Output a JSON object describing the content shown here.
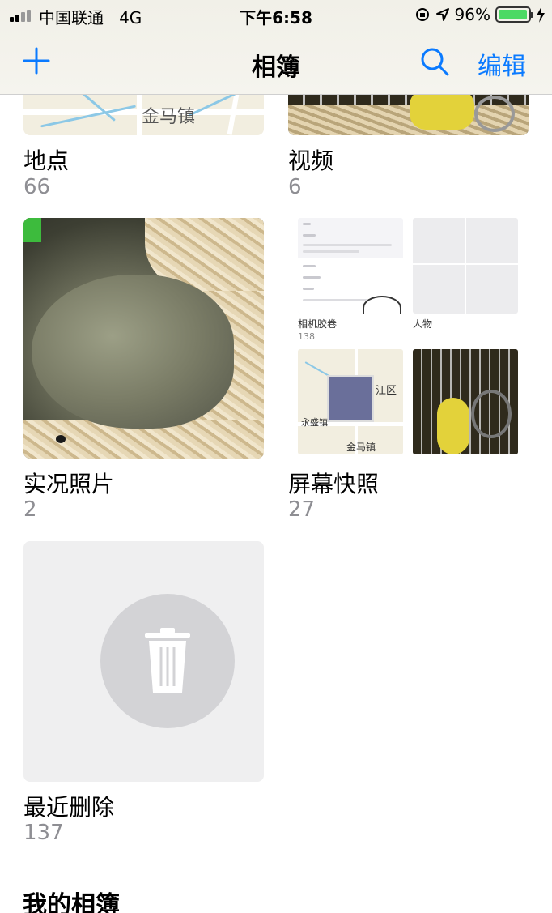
{
  "status_bar": {
    "carrier": "中国联通",
    "network": "4G",
    "time": "下午6:58",
    "battery": "96%",
    "battery_level": 0.96
  },
  "nav": {
    "title": "相簿",
    "edit_label": "编辑",
    "add_icon": "plus-icon",
    "search_icon": "search-icon"
  },
  "albums": [
    {
      "title": "地点",
      "count": "66",
      "map_label": "金马镇"
    },
    {
      "title": "视频",
      "count": "6"
    },
    {
      "title": "实况照片",
      "count": "2"
    },
    {
      "title": "屏幕快照",
      "count": "27",
      "mini": {
        "camera_roll": "相机胶卷",
        "camera_roll_count": "138",
        "people": "人物",
        "map_labels": [
          "江区",
          "永盛镇",
          "金马镇"
        ]
      }
    },
    {
      "title": "最近删除",
      "count": "137",
      "icon": "trash-icon"
    }
  ],
  "section": {
    "title": "我的相簿"
  },
  "colors": {
    "accent": "#0a7aff",
    "secondary_text": "#8e8e93",
    "battery": "#4cd964"
  }
}
